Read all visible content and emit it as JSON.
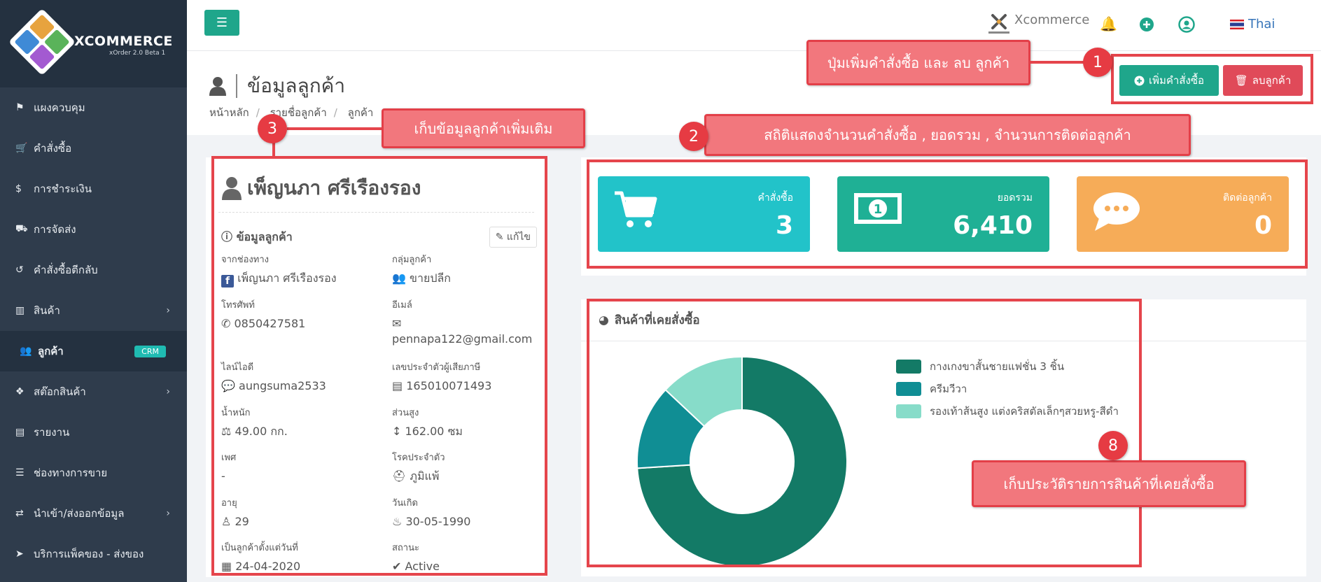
{
  "brand": {
    "name": "XCOMMERCE",
    "version": "xOrder 2.0 Beta 1"
  },
  "sidebar": {
    "items": [
      {
        "label": "แผงควบคุม",
        "icon": "flag-icon"
      },
      {
        "label": "คำสั่งซื้อ",
        "icon": "cart-icon"
      },
      {
        "label": "การชำระเงิน",
        "icon": "dollar-icon"
      },
      {
        "label": "การจัดส่ง",
        "icon": "truck-icon"
      },
      {
        "label": "คำสั่งซื้อตีกลับ",
        "icon": "undo-icon"
      },
      {
        "label": "สินค้า",
        "icon": "barcode-icon"
      },
      {
        "label": "ลูกค้า",
        "icon": "users-icon",
        "badge": "CRM"
      },
      {
        "label": "สต๊อกสินค้า",
        "icon": "cubes-icon"
      },
      {
        "label": "รายงาน",
        "icon": "bar-chart-icon"
      },
      {
        "label": "ช่องทางการขาย",
        "icon": "list-icon"
      },
      {
        "label": "นำเข้า/ส่งออกข้อมูล",
        "icon": "exchange-icon"
      },
      {
        "label": "บริการแพ็คของ - ส่งของ",
        "icon": "send-icon"
      }
    ]
  },
  "topbar": {
    "brand": "Xcommerce",
    "language": "Thai"
  },
  "page": {
    "title": "ข้อมูลลูกค้า",
    "breadcrumb": [
      "หน้าหลัก",
      "รายชื่อลูกค้า",
      "ลูกค้า"
    ],
    "add_order_button": "เพิ่มคำสั่งซื้อ",
    "delete_customer_button": "ลบลูกค้า"
  },
  "customer": {
    "name": "เพ็ญนภา ศรีเรืองรอง",
    "section_title": "ข้อมูลลูกค้า",
    "edit_label": "แก้ไข",
    "fields": {
      "channel": {
        "label": "จากช่องทาง",
        "value": "เพ็ญนภา ศรีเรืองรอง"
      },
      "group": {
        "label": "กลุ่มลูกค้า",
        "value": "ขายปลีก"
      },
      "phone": {
        "label": "โทรศัพท์",
        "value": "0850427581"
      },
      "email": {
        "label": "อีเมล์",
        "value": "pennapa122@gmail.com"
      },
      "line": {
        "label": "ไลน์ไอดี",
        "value": "aungsuma2533"
      },
      "tax": {
        "label": "เลขประจำตัวผู้เสียภาษี",
        "value": "165010071493"
      },
      "weight": {
        "label": "น้ำหนัก",
        "value": "49.00 กก."
      },
      "height": {
        "label": "ส่วนสูง",
        "value": "162.00 ซม"
      },
      "gender": {
        "label": "เพศ",
        "value": "-"
      },
      "disease": {
        "label": "โรคประจำตัว",
        "value": "ภูมิแพ้"
      },
      "age": {
        "label": "อายุ",
        "value": "29"
      },
      "birthday": {
        "label": "วันเกิด",
        "value": "30-05-1990"
      },
      "since": {
        "label": "เป็นลูกค้าตั้งแต่วันที่",
        "value": "24-04-2020"
      },
      "status": {
        "label": "สถานะ",
        "value": "Active"
      }
    }
  },
  "stats": [
    {
      "label": "คำสั่งซื้อ",
      "value": "3",
      "color": "#22c3c9"
    },
    {
      "label": "ยอดรวม",
      "value": "6,410",
      "color": "#1fb095"
    },
    {
      "label": "ติดต่อลูกค้า",
      "value": "0",
      "color": "#f6ac58"
    }
  ],
  "products_panel": {
    "title": "สินค้าที่เคยสั่งซื้อ"
  },
  "chart_data": {
    "type": "pie",
    "donut": true,
    "categories": [
      "กางเกงขาสั้นชายแฟชั่น 3 ชิ้น",
      "ครีมวีวา",
      "รองเท้าส้นสูง แต่งคริสตัลเล็กๆสวยหรู-สีดำ"
    ],
    "values": [
      74,
      13,
      13
    ],
    "colors": [
      "#137a66",
      "#108e94",
      "#87dcc9"
    ],
    "legend": "right"
  },
  "annotations": [
    {
      "number": "1",
      "text": "ปุ่มเพิ่มคำสั่งซื้อ และ ลบ ลูกค้า"
    },
    {
      "number": "2",
      "text": "สถิติแสดงจำนวนคำสั่งซื้อ , ยอดรวม , จำนวนการติดต่อลูกค้า"
    },
    {
      "number": "3",
      "text": "เก็บข้อมูลลูกค้าเพิ่มเติม"
    },
    {
      "number": "8",
      "text": "เก็บประวัติรายการสินค้าที่เคยสั่งซื้อ"
    }
  ]
}
